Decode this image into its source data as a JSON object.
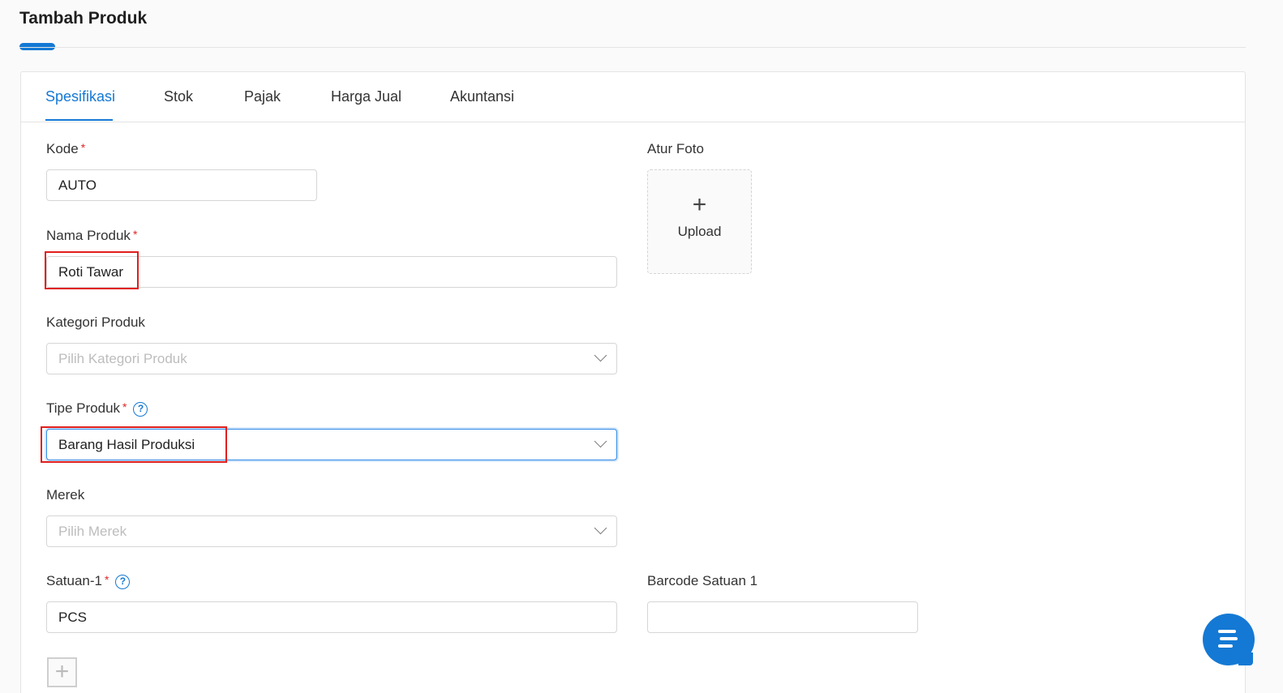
{
  "page": {
    "title": "Tambah Produk"
  },
  "tabs": [
    {
      "label": "Spesifikasi",
      "active": true
    },
    {
      "label": "Stok",
      "active": false
    },
    {
      "label": "Pajak",
      "active": false
    },
    {
      "label": "Harga Jual",
      "active": false
    },
    {
      "label": "Akuntansi",
      "active": false
    }
  ],
  "form": {
    "kode": {
      "label": "Kode",
      "required": "*",
      "value": "AUTO"
    },
    "nama_produk": {
      "label": "Nama Produk",
      "required": "*",
      "value": "Roti Tawar"
    },
    "kategori_produk": {
      "label": "Kategori Produk",
      "placeholder": "Pilih Kategori Produk"
    },
    "tipe_produk": {
      "label": "Tipe Produk",
      "required": "*",
      "help_icon": "question-circle-icon",
      "value": "Barang Hasil Produksi"
    },
    "merek": {
      "label": "Merek",
      "placeholder": "Pilih Merek"
    },
    "satuan_1": {
      "label": "Satuan-1",
      "required": "*",
      "help_icon": "question-circle-icon",
      "value": "PCS"
    },
    "barcode_satuan_1": {
      "label": "Barcode Satuan 1",
      "value": ""
    },
    "foto": {
      "label": "Atur Foto",
      "upload_label": "Upload",
      "icon": "plus-icon"
    }
  },
  "colors": {
    "accent": "#1479d4",
    "required": "#e02424",
    "highlight": "#e01e1e"
  },
  "chat": {
    "icon": "chat-icon"
  }
}
